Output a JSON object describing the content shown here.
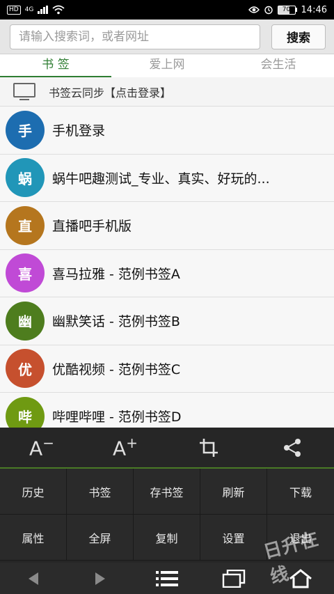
{
  "status_bar": {
    "network_badge": "HD",
    "network_type": "4G",
    "battery": "70",
    "battery_level": 0.7,
    "time": "14:46"
  },
  "search": {
    "placeholder": "请输入搜索词，或者网址",
    "button_label": "搜索"
  },
  "tabs": [
    {
      "label": "书 签",
      "active": true
    },
    {
      "label": "爱上网",
      "active": false
    },
    {
      "label": "会生活",
      "active": false
    }
  ],
  "sync": {
    "label": "书签云同步【点击登录】"
  },
  "bookmarks": [
    {
      "avatar": "手",
      "title": "手机登录",
      "color": "#1d6db0"
    },
    {
      "avatar": "蜗",
      "title": "蜗牛吧趣测试_专业、真实、好玩的...",
      "color": "#2196b8"
    },
    {
      "avatar": "直",
      "title": "直播吧手机版",
      "color": "#b5761e"
    },
    {
      "avatar": "喜",
      "title": "喜马拉雅 - 范例书签A",
      "color": "#c04ad6"
    },
    {
      "avatar": "幽",
      "title": "幽默笑话 - 范例书签B",
      "color": "#4e7d1e"
    },
    {
      "avatar": "优",
      "title": "优酷视频 - 范例书签C",
      "color": "#c6502e"
    },
    {
      "avatar": "哔",
      "title": "哔哩哔哩 - 范例书签D",
      "color": "#6f9a12"
    }
  ],
  "toolbar": {
    "font_smaller": "A",
    "font_smaller_sign": "−",
    "font_larger": "A",
    "font_larger_sign": "+"
  },
  "menu": [
    {
      "label": "历史",
      "name": "history"
    },
    {
      "label": "书签",
      "name": "bookmarks"
    },
    {
      "label": "存书签",
      "name": "save-bookmark"
    },
    {
      "label": "刷新",
      "name": "refresh"
    },
    {
      "label": "下载",
      "name": "download"
    },
    {
      "label": "属性",
      "name": "properties"
    },
    {
      "label": "全屏",
      "name": "fullscreen"
    },
    {
      "label": "复制",
      "name": "copy"
    },
    {
      "label": "设置",
      "name": "settings"
    },
    {
      "label": "退出",
      "name": "exit"
    }
  ],
  "watermark": "日升在线",
  "colors": {
    "accent": "#2e7d32",
    "panel": "#262626"
  }
}
